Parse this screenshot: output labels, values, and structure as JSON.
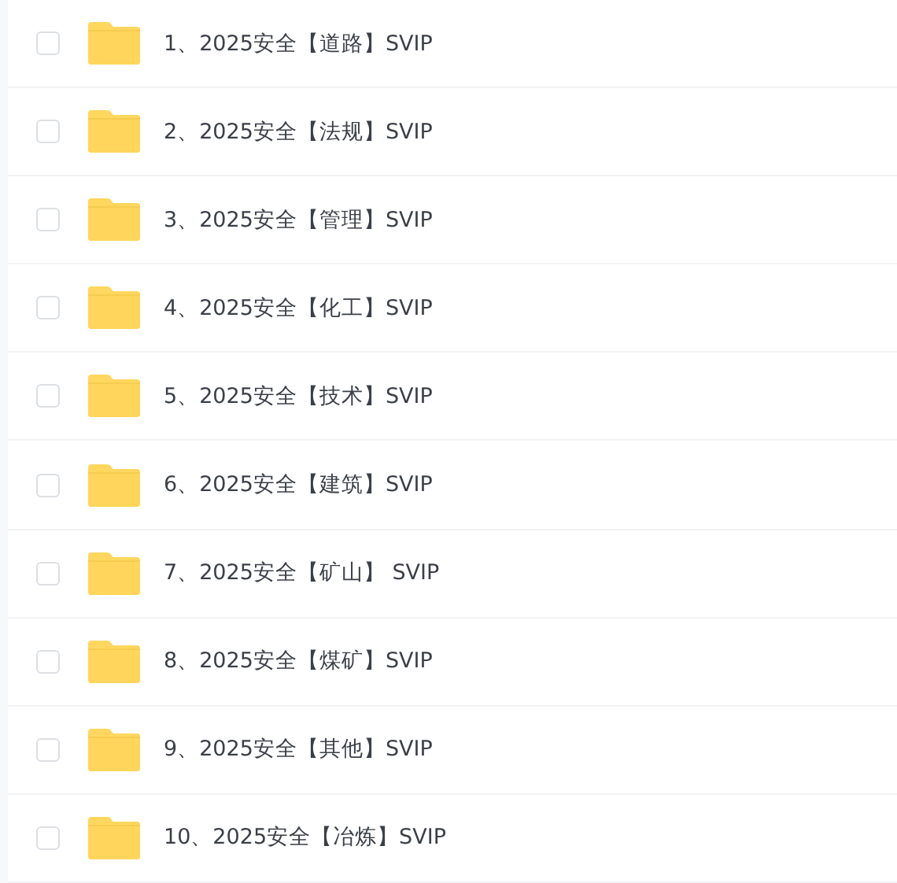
{
  "files": [
    {
      "name": "1、2025安全【道路】SVIP",
      "checked": false
    },
    {
      "name": "2、2025安全【法规】SVIP",
      "checked": false
    },
    {
      "name": "3、2025安全【管理】SVIP",
      "checked": false
    },
    {
      "name": "4、2025安全【化工】SVIP",
      "checked": false
    },
    {
      "name": "5、2025安全【技术】SVIP",
      "checked": false
    },
    {
      "name": "6、2025安全【建筑】SVIP",
      "checked": false
    },
    {
      "name": "7、2025安全【矿山】 SVIP",
      "checked": false
    },
    {
      "name": "8、2025安全【煤矿】SVIP",
      "checked": false
    },
    {
      "name": "9、2025安全【其他】SVIP",
      "checked": false
    },
    {
      "name": "10、2025安全【冶炼】SVIP",
      "checked": false
    }
  ]
}
